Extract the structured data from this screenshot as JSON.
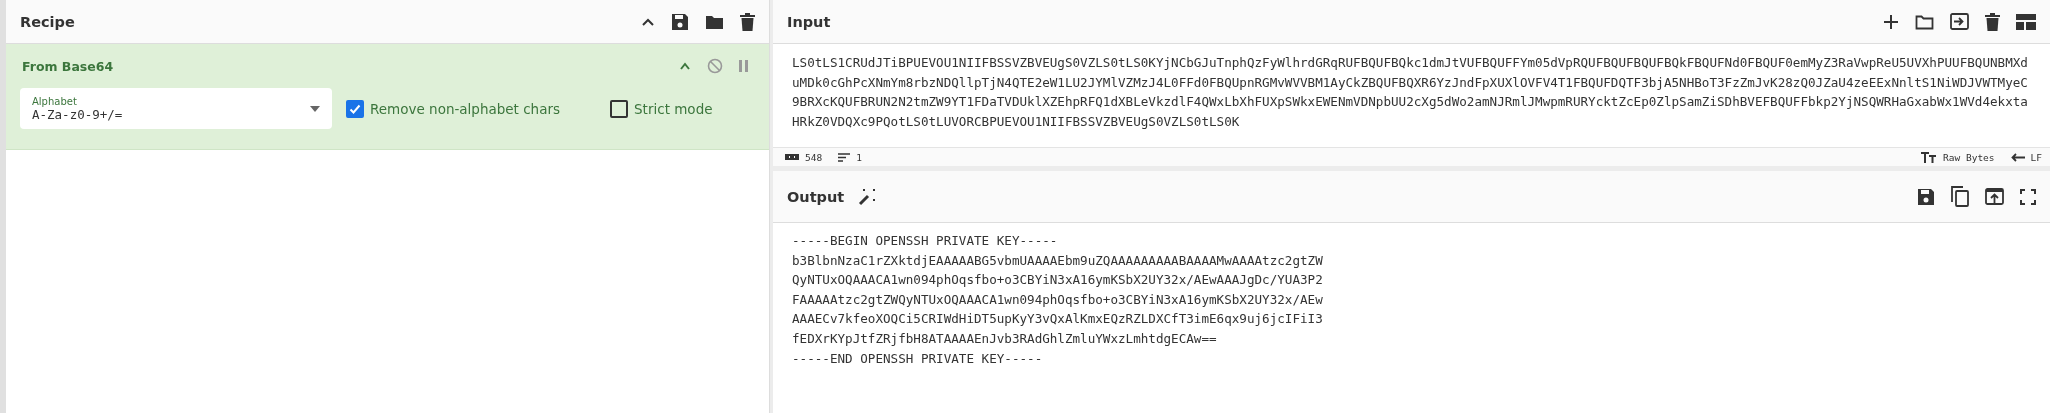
{
  "recipe": {
    "title": "Recipe",
    "operations": [
      {
        "name": "From Base64",
        "args": [
          {
            "kind": "dropdown",
            "label": "Alphabet",
            "value": "A-Za-z0-9+/="
          },
          {
            "kind": "checkbox",
            "label": "Remove non-alphabet chars",
            "checked": true
          },
          {
            "kind": "checkbox",
            "label": "Strict mode",
            "checked": false
          }
        ]
      }
    ]
  },
  "input": {
    "title": "Input",
    "text": "LS0tLS1CRUdJTiBPUEVOU1NIIFBSSVZBVEUgS0VZLS0tLS0KYjNCbGJuTnphQzFyWlhrdGRqRUFBQUFBQkc1dmJtVUFBQUFFYm05dVpRQUFBQUFBQUFBQkFBQUFNd0FBQUF0emMyZ3RaVwpReU5UVXhPUUFBQUNBMXduMDk0cGhPcXNmYm8rbzNDQllpTjN4QTE2eW1LU2JYMlVZMzJ4L0FFd0FBQUpnRGMvWVVBM1AyCkZBQUFBQXR6YzJndFpXUXlOVFV4T1FBQUFDQTF3bjA5NHBoT3FzZmJvK28zQ0JZaU4zeEExNnltS1NiWDJVWTMyeC9BRXcKQUFBRUN2N2tmZW9YT1FDaTVDUklXZEhpRFQ1dXBLeVkzdlF4QWxLbXhFUXpSWkxEWENmVDNpbUU2cXg5dWo2amNJRmlJMwpmRURYcktZcEp0ZlpSamZiSDhBVEFBQUFFbkp2YjNSQWRHaGxabWx1WVd4ekxtaHRkZ0VDQXc9PQotLS0tLUVORCBPUEVOU1NIIFBSSVZBVEUgS0VZLS0tLS0K",
    "status": {
      "length": "548",
      "lines": "1",
      "encoding": "Raw Bytes",
      "eol": "LF"
    }
  },
  "output": {
    "title": "Output",
    "lines": [
      "-----BEGIN OPENSSH PRIVATE KEY-----",
      "b3BlbnNzaC1rZXktdjEAAAAABG5vbmUAAAAEbm9uZQAAAAAAAAABAAAAMwAAAAtzc2gtZW",
      "QyNTUxOQAAACA1wn094phOqsfbo+o3CBYiN3xA16ymKSbX2UY32x/AEwAAAJgDc/YUA3P2",
      "FAAAAAtzc2gtZWQyNTUxOQAAACA1wn094phOqsfbo+o3CBYiN3xA16ymKSbX2UY32x/AEw",
      "AAAECv7kfeoXOQCi5CRIWdHiDT5upKyY3vQxAlKmxEQzRZLDXCfT3imE6qx9uj6jcIFiI3",
      "fEDXrKYpJtfZRjfbH8ATAAAAEnJvb3RAdGhlZmluYWxzLmhtdgECAw==",
      "-----END OPENSSH PRIVATE KEY-----"
    ]
  }
}
